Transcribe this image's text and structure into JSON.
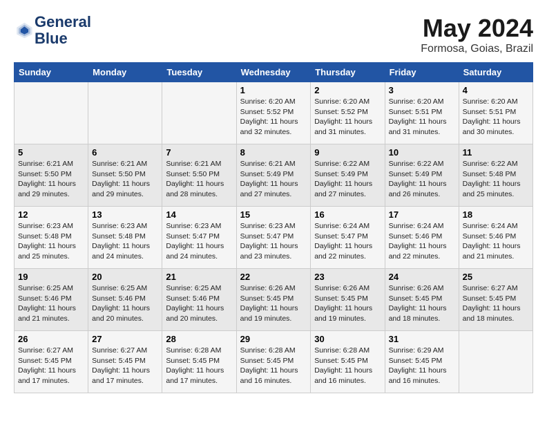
{
  "header": {
    "logo_line1": "General",
    "logo_line2": "Blue",
    "title": "May 2024",
    "subtitle": "Formosa, Goias, Brazil"
  },
  "weekdays": [
    "Sunday",
    "Monday",
    "Tuesday",
    "Wednesday",
    "Thursday",
    "Friday",
    "Saturday"
  ],
  "weeks": [
    [
      {
        "day": "",
        "info": ""
      },
      {
        "day": "",
        "info": ""
      },
      {
        "day": "",
        "info": ""
      },
      {
        "day": "1",
        "info": "Sunrise: 6:20 AM\nSunset: 5:52 PM\nDaylight: 11 hours and 32 minutes."
      },
      {
        "day": "2",
        "info": "Sunrise: 6:20 AM\nSunset: 5:52 PM\nDaylight: 11 hours and 31 minutes."
      },
      {
        "day": "3",
        "info": "Sunrise: 6:20 AM\nSunset: 5:51 PM\nDaylight: 11 hours and 31 minutes."
      },
      {
        "day": "4",
        "info": "Sunrise: 6:20 AM\nSunset: 5:51 PM\nDaylight: 11 hours and 30 minutes."
      }
    ],
    [
      {
        "day": "5",
        "info": "Sunrise: 6:21 AM\nSunset: 5:50 PM\nDaylight: 11 hours and 29 minutes."
      },
      {
        "day": "6",
        "info": "Sunrise: 6:21 AM\nSunset: 5:50 PM\nDaylight: 11 hours and 29 minutes."
      },
      {
        "day": "7",
        "info": "Sunrise: 6:21 AM\nSunset: 5:50 PM\nDaylight: 11 hours and 28 minutes."
      },
      {
        "day": "8",
        "info": "Sunrise: 6:21 AM\nSunset: 5:49 PM\nDaylight: 11 hours and 27 minutes."
      },
      {
        "day": "9",
        "info": "Sunrise: 6:22 AM\nSunset: 5:49 PM\nDaylight: 11 hours and 27 minutes."
      },
      {
        "day": "10",
        "info": "Sunrise: 6:22 AM\nSunset: 5:49 PM\nDaylight: 11 hours and 26 minutes."
      },
      {
        "day": "11",
        "info": "Sunrise: 6:22 AM\nSunset: 5:48 PM\nDaylight: 11 hours and 25 minutes."
      }
    ],
    [
      {
        "day": "12",
        "info": "Sunrise: 6:23 AM\nSunset: 5:48 PM\nDaylight: 11 hours and 25 minutes."
      },
      {
        "day": "13",
        "info": "Sunrise: 6:23 AM\nSunset: 5:48 PM\nDaylight: 11 hours and 24 minutes."
      },
      {
        "day": "14",
        "info": "Sunrise: 6:23 AM\nSunset: 5:47 PM\nDaylight: 11 hours and 24 minutes."
      },
      {
        "day": "15",
        "info": "Sunrise: 6:23 AM\nSunset: 5:47 PM\nDaylight: 11 hours and 23 minutes."
      },
      {
        "day": "16",
        "info": "Sunrise: 6:24 AM\nSunset: 5:47 PM\nDaylight: 11 hours and 22 minutes."
      },
      {
        "day": "17",
        "info": "Sunrise: 6:24 AM\nSunset: 5:46 PM\nDaylight: 11 hours and 22 minutes."
      },
      {
        "day": "18",
        "info": "Sunrise: 6:24 AM\nSunset: 5:46 PM\nDaylight: 11 hours and 21 minutes."
      }
    ],
    [
      {
        "day": "19",
        "info": "Sunrise: 6:25 AM\nSunset: 5:46 PM\nDaylight: 11 hours and 21 minutes."
      },
      {
        "day": "20",
        "info": "Sunrise: 6:25 AM\nSunset: 5:46 PM\nDaylight: 11 hours and 20 minutes."
      },
      {
        "day": "21",
        "info": "Sunrise: 6:25 AM\nSunset: 5:46 PM\nDaylight: 11 hours and 20 minutes."
      },
      {
        "day": "22",
        "info": "Sunrise: 6:26 AM\nSunset: 5:45 PM\nDaylight: 11 hours and 19 minutes."
      },
      {
        "day": "23",
        "info": "Sunrise: 6:26 AM\nSunset: 5:45 PM\nDaylight: 11 hours and 19 minutes."
      },
      {
        "day": "24",
        "info": "Sunrise: 6:26 AM\nSunset: 5:45 PM\nDaylight: 11 hours and 18 minutes."
      },
      {
        "day": "25",
        "info": "Sunrise: 6:27 AM\nSunset: 5:45 PM\nDaylight: 11 hours and 18 minutes."
      }
    ],
    [
      {
        "day": "26",
        "info": "Sunrise: 6:27 AM\nSunset: 5:45 PM\nDaylight: 11 hours and 17 minutes."
      },
      {
        "day": "27",
        "info": "Sunrise: 6:27 AM\nSunset: 5:45 PM\nDaylight: 11 hours and 17 minutes."
      },
      {
        "day": "28",
        "info": "Sunrise: 6:28 AM\nSunset: 5:45 PM\nDaylight: 11 hours and 17 minutes."
      },
      {
        "day": "29",
        "info": "Sunrise: 6:28 AM\nSunset: 5:45 PM\nDaylight: 11 hours and 16 minutes."
      },
      {
        "day": "30",
        "info": "Sunrise: 6:28 AM\nSunset: 5:45 PM\nDaylight: 11 hours and 16 minutes."
      },
      {
        "day": "31",
        "info": "Sunrise: 6:29 AM\nSunset: 5:45 PM\nDaylight: 11 hours and 16 minutes."
      },
      {
        "day": "",
        "info": ""
      }
    ]
  ]
}
